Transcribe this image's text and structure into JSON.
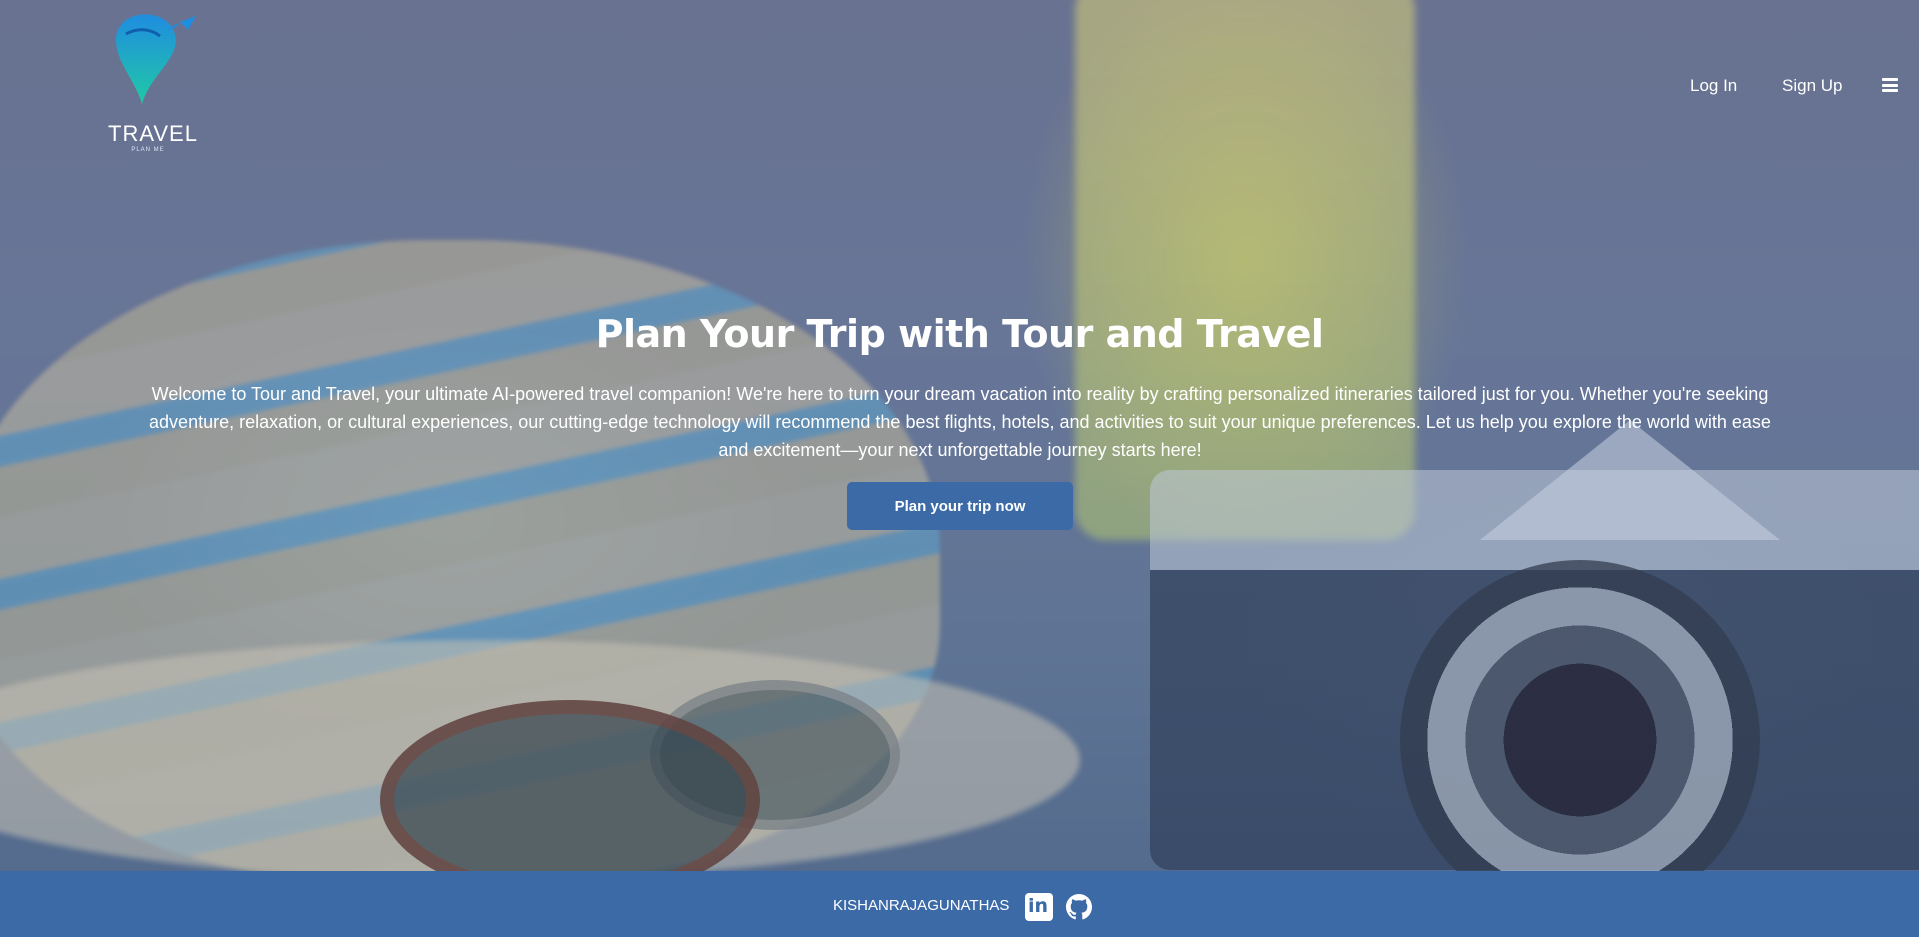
{
  "header": {
    "logo": {
      "text": "TRAVEL",
      "subtext": "PLAN ME"
    },
    "nav": {
      "login": "Log In",
      "signup": "Sign Up"
    },
    "menu_icon": "hamburger-menu-icon"
  },
  "hero": {
    "title": "Plan Your Trip with Tour and Travel",
    "description": "Welcome to Tour and Travel, your ultimate AI-powered travel companion! We're here to turn your dream vacation into reality by crafting personalized itineraries tailored just for you. Whether you're seeking adventure, relaxation, or cultural experiences, our cutting-edge technology will recommend the best flights, hotels, and activities to suit your unique preferences. Let us help you explore the world with ease and excitement—your next unforgettable journey starts here!",
    "cta_label": "Plan your trip now"
  },
  "footer": {
    "name": "KISHANRAJAGUNATHAS",
    "icons": [
      "linkedin-icon",
      "github-icon"
    ]
  },
  "colors": {
    "accent": "#3b6aa6",
    "footer_bg": "#3b6aa6",
    "text": "#ffffff"
  }
}
